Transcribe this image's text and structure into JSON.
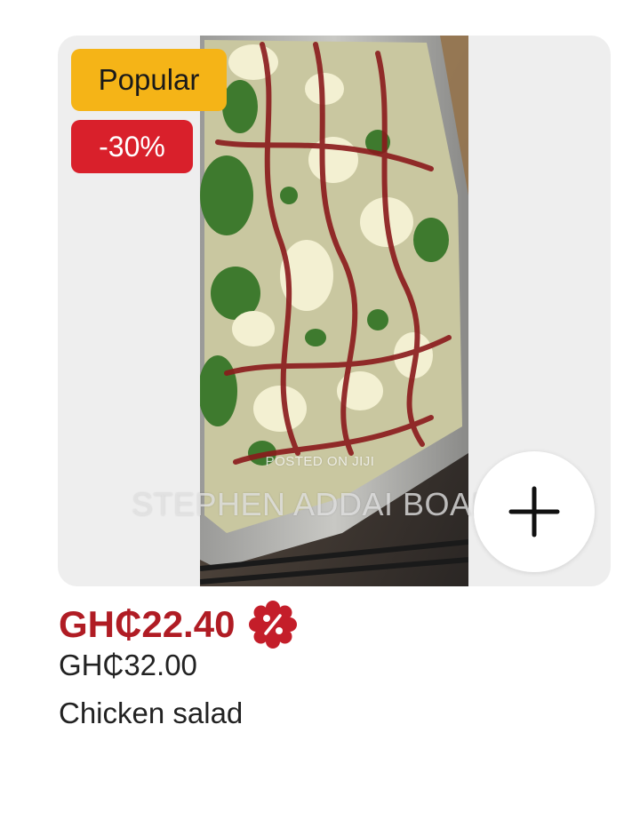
{
  "badges": {
    "popular": "Popular",
    "discount": "-30%"
  },
  "watermark": {
    "small": "POSTED ON JIJI",
    "large": "STEPHEN ADDAI BOAMAH"
  },
  "product": {
    "price_current": "GH₵22.40",
    "price_old": "GH₵32.00",
    "name": "Chicken salad"
  },
  "icons": {
    "add": "plus-icon",
    "discount": "discount-percent-icon"
  },
  "colors": {
    "popular_badge": "#f5b417",
    "discount_badge": "#d9202b",
    "price": "#b01c24"
  }
}
